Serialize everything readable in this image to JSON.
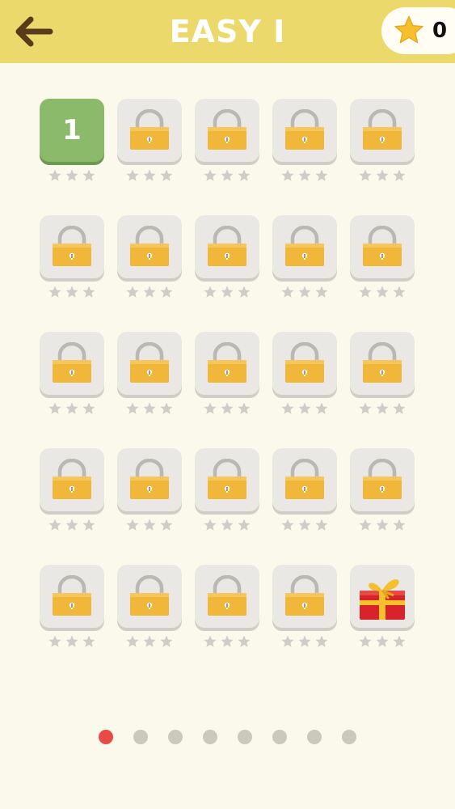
{
  "header": {
    "back_icon": "arrow-left-icon",
    "title": "EASY I",
    "score": "0",
    "score_icon": "star-icon"
  },
  "levels": [
    {
      "label": "1",
      "state": "unlocked",
      "stars": 0
    },
    {
      "label": "",
      "state": "locked",
      "stars": 0
    },
    {
      "label": "",
      "state": "locked",
      "stars": 0
    },
    {
      "label": "",
      "state": "locked",
      "stars": 0
    },
    {
      "label": "",
      "state": "locked",
      "stars": 0
    },
    {
      "label": "",
      "state": "locked",
      "stars": 0
    },
    {
      "label": "",
      "state": "locked",
      "stars": 0
    },
    {
      "label": "",
      "state": "locked",
      "stars": 0
    },
    {
      "label": "",
      "state": "locked",
      "stars": 0
    },
    {
      "label": "",
      "state": "locked",
      "stars": 0
    },
    {
      "label": "",
      "state": "locked",
      "stars": 0
    },
    {
      "label": "",
      "state": "locked",
      "stars": 0
    },
    {
      "label": "",
      "state": "locked",
      "stars": 0
    },
    {
      "label": "",
      "state": "locked",
      "stars": 0
    },
    {
      "label": "",
      "state": "locked",
      "stars": 0
    },
    {
      "label": "",
      "state": "locked",
      "stars": 0
    },
    {
      "label": "",
      "state": "locked",
      "stars": 0
    },
    {
      "label": "",
      "state": "locked",
      "stars": 0
    },
    {
      "label": "",
      "state": "locked",
      "stars": 0
    },
    {
      "label": "",
      "state": "locked",
      "stars": 0
    },
    {
      "label": "",
      "state": "locked",
      "stars": 0
    },
    {
      "label": "",
      "state": "locked",
      "stars": 0
    },
    {
      "label": "",
      "state": "locked",
      "stars": 0
    },
    {
      "label": "",
      "state": "locked",
      "stars": 0
    },
    {
      "label": "",
      "state": "gift",
      "stars": 0
    }
  ],
  "pagination": {
    "pages": 8,
    "current": 1
  },
  "colors": {
    "header": "#ecd96c",
    "background": "#fbf9ec",
    "unlocked_tile": "#8bbb6a",
    "locked_tile": "#e9e8e5",
    "lock": "#f1b73a",
    "star_empty": "#cfcdc8",
    "star_gold": "#f5c02c",
    "dot_active": "#e84b45",
    "dot_inactive": "#cbc8bc"
  }
}
